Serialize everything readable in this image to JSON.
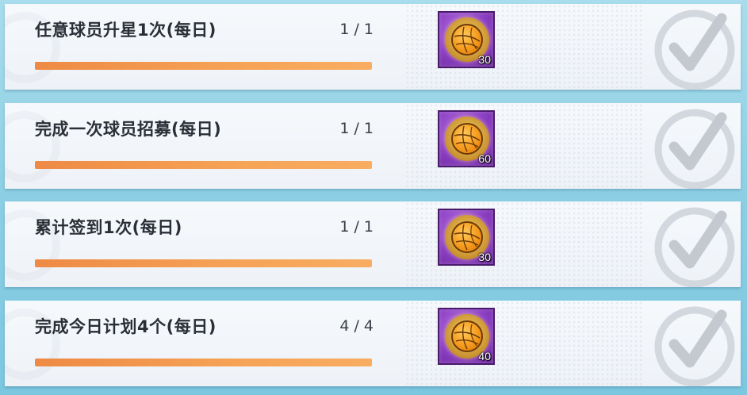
{
  "tasks": [
    {
      "title": "任意球员升星1次(每日)",
      "progress_text": "1 / 1",
      "progress": 1.0,
      "reward": {
        "icon": "volleyball-coin-icon",
        "count": "30"
      },
      "status": "claimed-check-icon"
    },
    {
      "title": "完成一次球员招募(每日)",
      "progress_text": "1 / 1",
      "progress": 1.0,
      "reward": {
        "icon": "volleyball-coin-icon",
        "count": "60"
      },
      "status": "claimed-check-icon"
    },
    {
      "title": "累计签到1次(每日)",
      "progress_text": "1 / 1",
      "progress": 1.0,
      "reward": {
        "icon": "volleyball-coin-icon",
        "count": "30"
      },
      "status": "claimed-check-icon"
    },
    {
      "title": "完成今日计划4个(每日)",
      "progress_text": "4 / 4",
      "progress": 1.0,
      "reward": {
        "icon": "volleyball-coin-icon",
        "count": "40"
      },
      "status": "claimed-check-icon"
    }
  ],
  "colors": {
    "progress_fill": "#f29a4f",
    "reward_bg": "#8c3fc4",
    "card_bg": "#f3f6fa",
    "page_bg": "#8ccfe4"
  }
}
